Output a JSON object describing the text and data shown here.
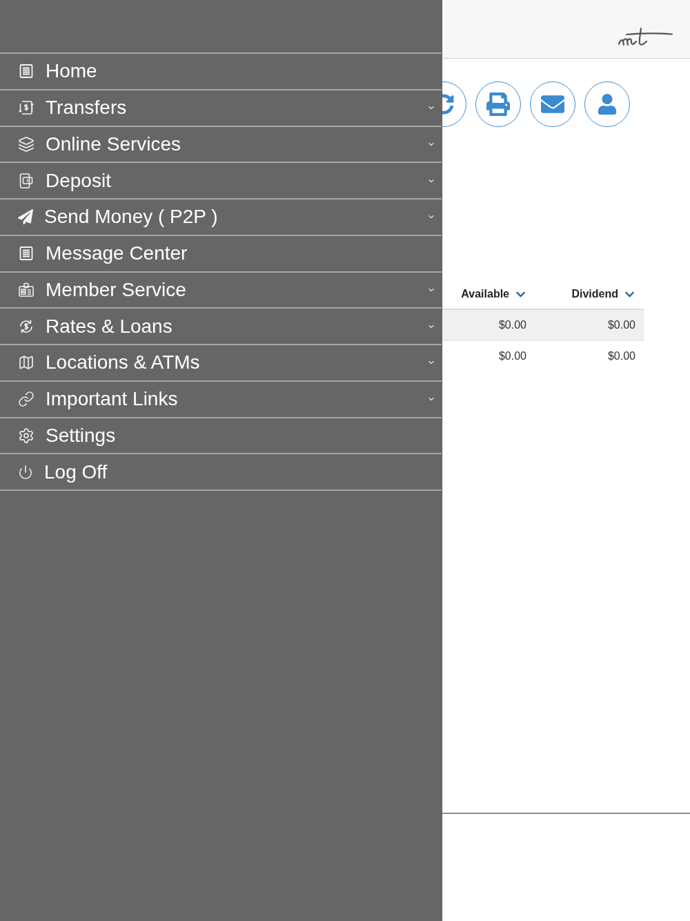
{
  "drawer": {
    "items": [
      {
        "label": "Home",
        "has_submenu": false
      },
      {
        "label": "Transfers",
        "has_submenu": true
      },
      {
        "label": "Online Services",
        "has_submenu": true
      },
      {
        "label": "Deposit",
        "has_submenu": true
      },
      {
        "label": "Send Money ( P2P )",
        "has_submenu": true
      },
      {
        "label": "Message Center",
        "has_submenu": false
      },
      {
        "label": "Member Service",
        "has_submenu": true
      },
      {
        "label": "Rates & Loans",
        "has_submenu": true
      },
      {
        "label": "Locations & ATMs",
        "has_submenu": true
      },
      {
        "label": "Important Links",
        "has_submenu": true
      },
      {
        "label": "Settings",
        "has_submenu": false
      },
      {
        "label": "Log Off",
        "has_submenu": false
      }
    ]
  },
  "table": {
    "columns": [
      {
        "label": "Available"
      },
      {
        "label": "Dividend"
      }
    ],
    "rows": [
      {
        "cells": [
          "$0.00",
          "$0.00"
        ]
      },
      {
        "cells": [
          "$0.00",
          "$0.00"
        ]
      }
    ]
  }
}
